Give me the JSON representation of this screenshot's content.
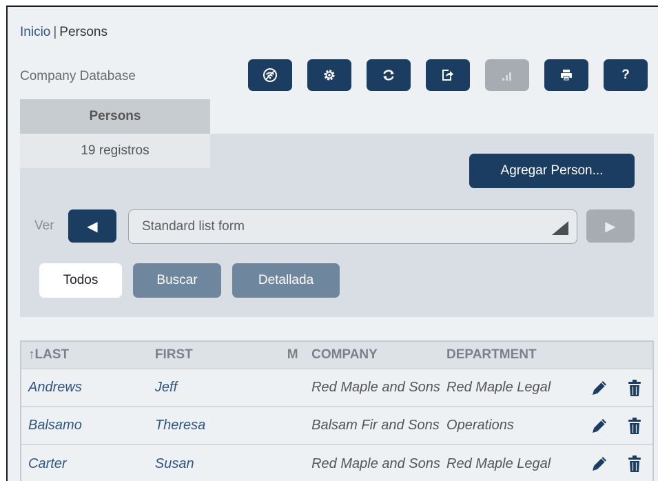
{
  "breadcrumb": {
    "home": "Inicio",
    "separator": "|",
    "current": "Persons"
  },
  "app": {
    "database_name": "Company Database"
  },
  "toolbar": {
    "buttons": [
      {
        "name": "no-wifi-icon",
        "enabled": true
      },
      {
        "name": "settings-icon",
        "enabled": true
      },
      {
        "name": "refresh-icon",
        "enabled": true
      },
      {
        "name": "export-icon",
        "enabled": true
      },
      {
        "name": "chart-icon",
        "enabled": false
      },
      {
        "name": "print-icon",
        "enabled": true
      },
      {
        "name": "help-icon",
        "label": "?",
        "enabled": true
      }
    ]
  },
  "table_tab": {
    "label": "Persons",
    "record_count": "19 registros"
  },
  "actions": {
    "add_label": "Agregar Person..."
  },
  "view": {
    "label": "Ver",
    "prev_icon": "◀",
    "next_icon": "▶",
    "selected_form": "Standard list form"
  },
  "modes": {
    "all": "Todos",
    "search": "Buscar",
    "detailed": "Detallada"
  },
  "table": {
    "columns": [
      "↑LAST",
      "FIRST",
      "M",
      "COMPANY",
      "DEPARTMENT"
    ],
    "rows": [
      {
        "last": "Andrews",
        "first": "Jeff",
        "m": "",
        "company": "Red Maple and Sons",
        "department": "Red Maple Legal"
      },
      {
        "last": "Balsamo",
        "first": "Theresa",
        "m": "",
        "company": "Balsam Fir and Sons",
        "department": "Operations"
      },
      {
        "last": "Carter",
        "first": "Susan",
        "m": "",
        "company": "Red Maple and Sons",
        "department": "Red Maple Legal"
      }
    ]
  },
  "colors": {
    "primary": "#1c3d62",
    "disabled": "#a6acb1",
    "mode": "#6f879e",
    "link": "#2f557f"
  }
}
